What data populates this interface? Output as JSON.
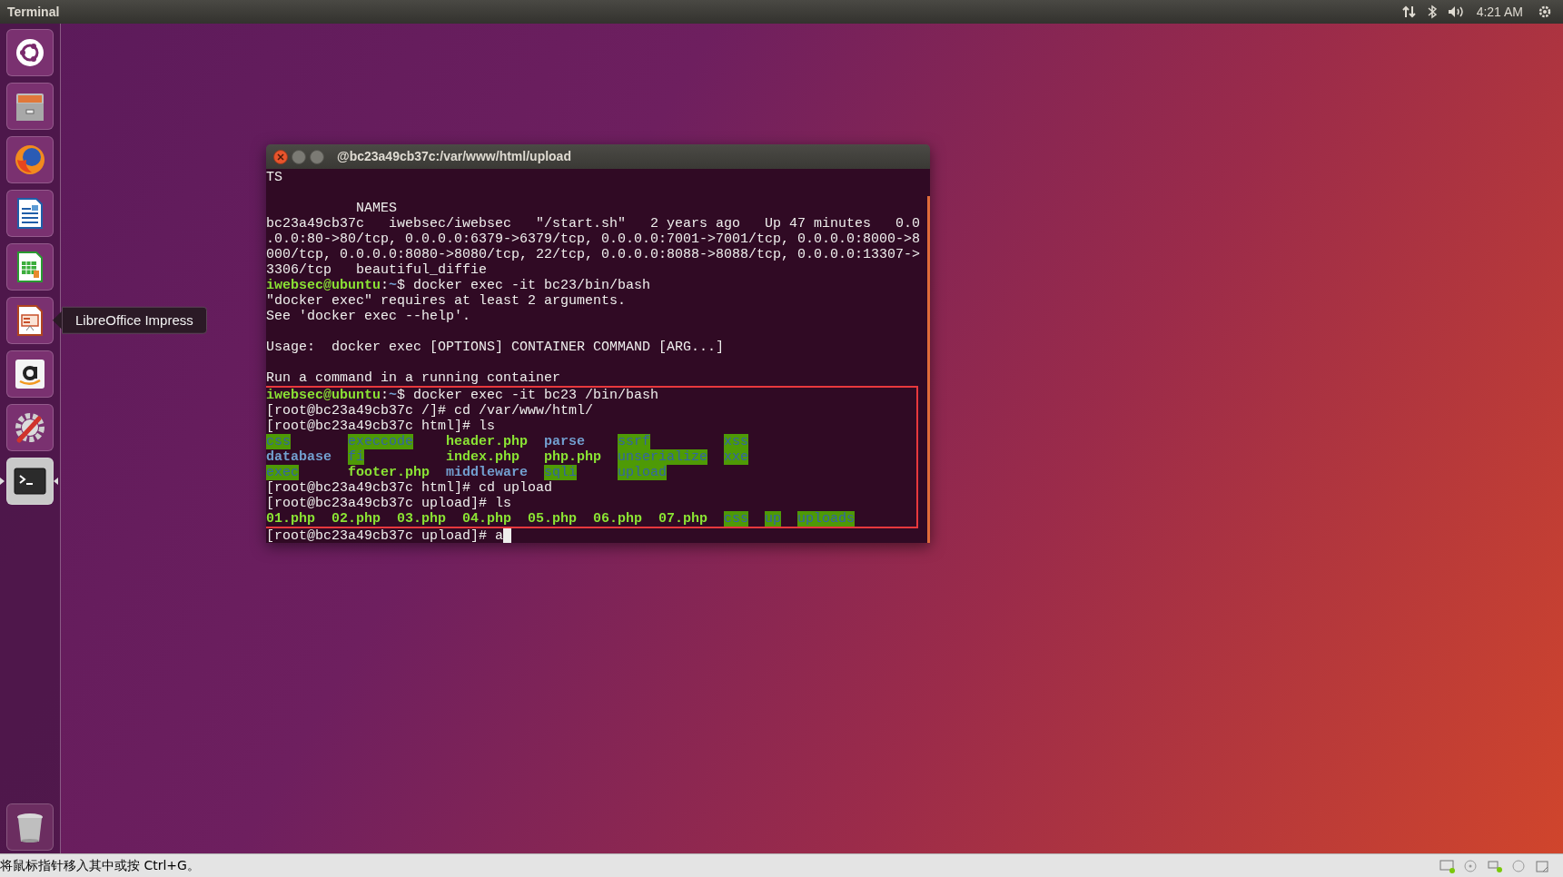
{
  "top_bar": {
    "title": "Terminal",
    "time": "4:21 AM"
  },
  "launcher": {
    "items": [
      {
        "kind": "dash",
        "running": false
      },
      {
        "kind": "files",
        "running": false
      },
      {
        "kind": "firefox",
        "running": false
      },
      {
        "kind": "writer",
        "running": false
      },
      {
        "kind": "calc",
        "running": false
      },
      {
        "kind": "impress",
        "running": false,
        "tooltip": "LibreOffice Impress"
      },
      {
        "kind": "amazon",
        "running": false
      },
      {
        "kind": "settings",
        "running": false
      },
      {
        "kind": "terminal",
        "running": true
      }
    ],
    "bottom_items": [
      {
        "kind": "trash",
        "running": false
      }
    ]
  },
  "terminal": {
    "title": "@bc23a49cb37c:/var/www/html/upload",
    "blocks": [
      {
        "boxed": false,
        "lines": [
          {
            "kind": "text",
            "cursor": false,
            "segs": [
              {
                "text": "TS",
                "kind": "plain"
              }
            ]
          },
          {
            "kind": "blank"
          },
          {
            "kind": "text",
            "cursor": false,
            "segs": [
              {
                "text": "           NAMES",
                "kind": "plain"
              }
            ]
          },
          {
            "kind": "text",
            "cursor": false,
            "segs": [
              {
                "text": "bc23a49cb37c   iwebsec/iwebsec   \"/start.sh\"   2 years ago   Up 47 minutes   0.0",
                "kind": "plain"
              }
            ]
          },
          {
            "kind": "text",
            "cursor": false,
            "segs": [
              {
                "text": ".0.0:80->80/tcp, 0.0.0.0:6379->6379/tcp, 0.0.0.0:7001->7001/tcp, 0.0.0.0:8000->8",
                "kind": "plain"
              }
            ]
          },
          {
            "kind": "text",
            "cursor": false,
            "segs": [
              {
                "text": "000/tcp, 0.0.0.0:8080->8080/tcp, 22/tcp, 0.0.0.0:8088->8088/tcp, 0.0.0.0:13307->",
                "kind": "plain"
              }
            ]
          },
          {
            "kind": "text",
            "cursor": false,
            "segs": [
              {
                "text": "3306/tcp   beautiful_diffie",
                "kind": "plain"
              }
            ]
          },
          {
            "kind": "text",
            "cursor": false,
            "segs": [
              {
                "text": "iwebsec@ubuntu",
                "kind": "user"
              },
              {
                "text": ":",
                "kind": "plain"
              },
              {
                "text": "~",
                "kind": "path"
              },
              {
                "text": "$ docker exec -it bc23/bin/bash",
                "kind": "plain"
              }
            ]
          },
          {
            "kind": "text",
            "cursor": false,
            "segs": [
              {
                "text": "\"docker exec\" requires at least 2 arguments.",
                "kind": "plain"
              }
            ]
          },
          {
            "kind": "text",
            "cursor": false,
            "segs": [
              {
                "text": "See 'docker exec --help'.",
                "kind": "plain"
              }
            ]
          },
          {
            "kind": "blank"
          },
          {
            "kind": "text",
            "cursor": false,
            "segs": [
              {
                "text": "Usage:  docker exec [OPTIONS] CONTAINER COMMAND [ARG...]",
                "kind": "plain"
              }
            ]
          },
          {
            "kind": "blank"
          },
          {
            "kind": "text",
            "cursor": false,
            "segs": [
              {
                "text": "Run a command in a running container",
                "kind": "plain"
              }
            ]
          }
        ]
      },
      {
        "boxed": true,
        "lines": [
          {
            "kind": "text",
            "cursor": false,
            "segs": [
              {
                "text": "iwebsec@ubuntu",
                "kind": "user"
              },
              {
                "text": ":",
                "kind": "plain"
              },
              {
                "text": "~",
                "kind": "path"
              },
              {
                "text": "$ docker exec -it bc23 /bin/bash",
                "kind": "plain"
              }
            ]
          },
          {
            "kind": "text",
            "cursor": false,
            "segs": [
              {
                "text": "[root@bc23a49cb37c /]# cd /var/www/html/",
                "kind": "plain"
              }
            ]
          },
          {
            "kind": "text",
            "cursor": false,
            "segs": [
              {
                "text": "[root@bc23a49cb37c html]# ls",
                "kind": "plain"
              }
            ]
          },
          {
            "kind": "listing",
            "rows": [
              [
                {
                  "text": "css",
                  "kind": "dir_hl"
                },
                {
                  "text": "execcode",
                  "kind": "dir_hl"
                },
                {
                  "text": "header.php",
                  "kind": "exec"
                },
                {
                  "text": "parse",
                  "kind": "dir"
                },
                {
                  "text": "ssrf",
                  "kind": "dir_hl"
                },
                {
                  "text": "xss",
                  "kind": "dir_hl"
                }
              ],
              [
                {
                  "text": "database",
                  "kind": "dir"
                },
                {
                  "text": "fi",
                  "kind": "dir_hl"
                },
                {
                  "text": "index.php",
                  "kind": "exec"
                },
                {
                  "text": "php.php",
                  "kind": "exec"
                },
                {
                  "text": "unserialize",
                  "kind": "dir_hl"
                },
                {
                  "text": "xxe",
                  "kind": "dir_hl"
                }
              ],
              [
                {
                  "text": "exec",
                  "kind": "dir_hl"
                },
                {
                  "text": "footer.php",
                  "kind": "exec"
                },
                {
                  "text": "middleware",
                  "kind": "dir"
                },
                {
                  "text": "sqli",
                  "kind": "dir_hl"
                },
                {
                  "text": "upload",
                  "kind": "dir_hl"
                }
              ]
            ]
          },
          {
            "kind": "text",
            "cursor": false,
            "segs": [
              {
                "text": "[root@bc23a49cb37c html]# cd upload",
                "kind": "plain"
              }
            ]
          },
          {
            "kind": "text",
            "cursor": false,
            "segs": [
              {
                "text": "[root@bc23a49cb37c upload]# ls",
                "kind": "plain"
              }
            ]
          },
          {
            "kind": "listing",
            "rows": [
              [
                {
                  "text": "01.php",
                  "kind": "exec"
                },
                {
                  "text": "02.php",
                  "kind": "exec"
                },
                {
                  "text": "03.php",
                  "kind": "exec"
                },
                {
                  "text": "04.php",
                  "kind": "exec"
                },
                {
                  "text": "05.php",
                  "kind": "exec"
                },
                {
                  "text": "06.php",
                  "kind": "exec"
                },
                {
                  "text": "07.php",
                  "kind": "exec"
                },
                {
                  "text": "css",
                  "kind": "dir_hl"
                },
                {
                  "text": "up",
                  "kind": "dir_hl"
                },
                {
                  "text": "uploads",
                  "kind": "dir_hl"
                }
              ]
            ]
          }
        ]
      },
      {
        "boxed": false,
        "lines": [
          {
            "kind": "text",
            "cursor": true,
            "segs": [
              {
                "text": "[root@bc23a49cb37c upload]# a",
                "kind": "plain"
              }
            ]
          }
        ]
      }
    ]
  },
  "status_bar": {
    "hint": "将鼠标指针移入其中或按 Ctrl+G。"
  }
}
